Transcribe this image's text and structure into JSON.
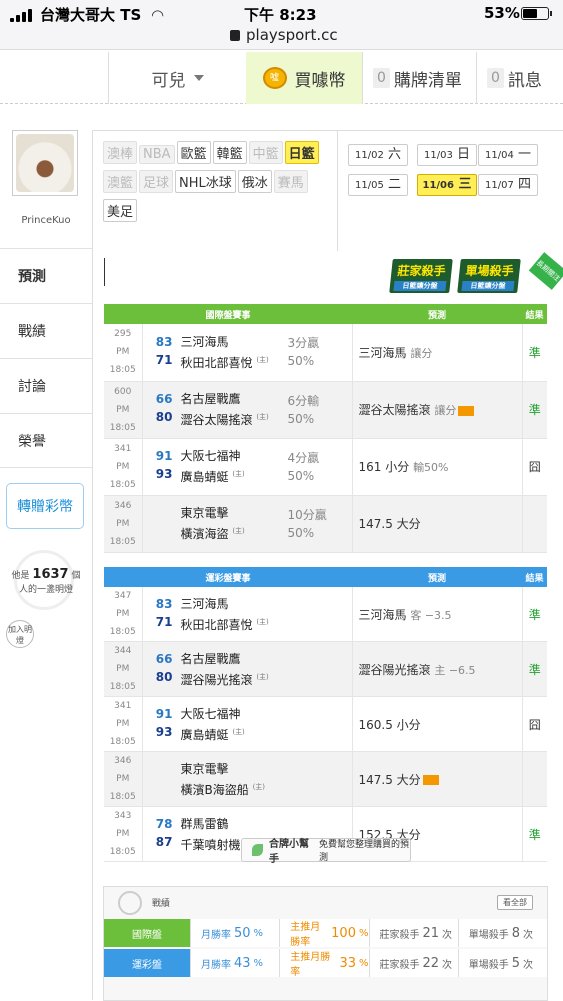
{
  "status_bar": {
    "carrier": "台灣大哥大 TS",
    "time": "下午 8:23",
    "url": "playsport.cc",
    "battery": "53%",
    "battery_level": 0.53
  },
  "top_nav": {
    "user_label": "可兒",
    "buy_label": "買噱幣",
    "coin_icon_text": "噓",
    "watch_count": "0",
    "watch_label": "購牌清單",
    "msg_count": "0",
    "msg_label": "訊息"
  },
  "profile": {
    "name": "PrinceKuo"
  },
  "left_nav": {
    "items": [
      "預測",
      "戰績",
      "討論",
      "榮譽"
    ],
    "gift_button": "轉贈彩幣",
    "bulb_prefix": "他是",
    "bulb_count": "1637",
    "bulb_suffix1": "個",
    "bulb_suffix2": "人的一盞明燈",
    "add_button": "加入明燈"
  },
  "sport_tags": [
    {
      "label": "澳棒",
      "state": "disabled"
    },
    {
      "label": "NBA",
      "state": "disabled"
    },
    {
      "label": "歐籃",
      "state": "normal"
    },
    {
      "label": "韓籃",
      "state": "normal"
    },
    {
      "label": "中籃",
      "state": "disabled"
    },
    {
      "label": "日籃",
      "state": "selected"
    },
    {
      "label": "澳籃",
      "state": "disabled"
    },
    {
      "label": "足球",
      "state": "disabled"
    },
    {
      "label": "NHL冰球",
      "state": "normal"
    },
    {
      "label": "俄冰",
      "state": "normal"
    },
    {
      "label": "賽馬",
      "state": "disabled"
    },
    {
      "label": "美足",
      "state": "normal"
    }
  ],
  "dates": [
    {
      "md": "11/02",
      "dow": "六"
    },
    {
      "md": "11/03",
      "dow": "日"
    },
    {
      "md": "11/04",
      "dow": "一"
    },
    {
      "md": "11/05",
      "dow": "二"
    },
    {
      "md": "11/06",
      "dow": "三"
    },
    {
      "md": "11/07",
      "dow": "四"
    }
  ],
  "badges": {
    "kill1_title": "莊家殺手",
    "kill1_sub": "日籃讓分盤",
    "kill2_title": "單場殺手",
    "kill2_sub": "日籃讓分盤",
    "ribbon": "長期關注"
  },
  "intl_table": {
    "header": {
      "game": "國際盤賽事",
      "pred": "預測",
      "result": "結果"
    },
    "color": "#6cbf3b",
    "rows": [
      {
        "id": "295",
        "time": "PM 18:05",
        "s1": "83",
        "t1": "三河海馬",
        "s2": "71",
        "t2": "秋田北部喜悅",
        "home": "(主)",
        "odds1": "3分贏",
        "odds2": "50%",
        "pred": "三河海馬",
        "pred_sub": "讓分",
        "hot": false,
        "result": "準"
      },
      {
        "id": "600",
        "time": "PM 18:05",
        "s1": "66",
        "t1": "名古屋戰鷹",
        "s2": "80",
        "t2": "澀谷太陽搖滾",
        "home": "(主)",
        "odds1": "6分輸",
        "odds2": "50%",
        "pred": "澀谷太陽搖滾",
        "pred_sub": "讓分",
        "hot": true,
        "result": "準"
      },
      {
        "id": "341",
        "time": "PM 18:05",
        "s1": "91",
        "t1": "大阪七福神",
        "s2": "93",
        "t2": "廣島蜻蜓",
        "home": "(主)",
        "odds1": "4分贏",
        "odds2": "50%",
        "pred": "161 小分",
        "pred_sub": "輸50%",
        "hot": false,
        "result": "囧"
      },
      {
        "id": "346",
        "time": "PM 18:05",
        "s1": "",
        "t1": "東京電擊",
        "s2": "",
        "t2": "橫濱海盜",
        "home": "(主)",
        "odds1": "10分贏",
        "odds2": "50%",
        "pred": "147.5 大分",
        "pred_sub": "",
        "hot": false,
        "result": ""
      }
    ]
  },
  "lottery_table": {
    "header": {
      "game": "運彩盤賽事",
      "pred": "預測",
      "result": "結果"
    },
    "color": "#3a9be4",
    "rows": [
      {
        "id": "347",
        "time": "PM 18:05",
        "s1": "83",
        "t1": "三河海馬",
        "s2": "71",
        "t2": "秋田北部喜悅",
        "home": "(主)",
        "pred": "三河海馬",
        "pred_sub": "客 −3.5",
        "hot": false,
        "result": "準"
      },
      {
        "id": "344",
        "time": "PM 18:05",
        "s1": "66",
        "t1": "名古屋戰鷹",
        "s2": "80",
        "t2": "澀谷陽光搖滾",
        "home": "(主)",
        "pred": "澀谷陽光搖滾",
        "pred_sub": "主 −6.5",
        "hot": false,
        "result": "準"
      },
      {
        "id": "341",
        "time": "PM 18:05",
        "s1": "91",
        "t1": "大阪七福神",
        "s2": "93",
        "t2": "廣島蜻蜓",
        "home": "(主)",
        "pred": "160.5 小分",
        "pred_sub": "",
        "hot": false,
        "result": "囧"
      },
      {
        "id": "346",
        "time": "PM 18:05",
        "s1": "",
        "t1": "東京電擊",
        "s2": "",
        "t2": "橫濱B海盜船",
        "home": "(主)",
        "pred": "147.5 大分",
        "pred_sub": "",
        "hot": true,
        "result": ""
      },
      {
        "id": "343",
        "time": "PM 18:05",
        "s1": "78",
        "t1": "群馬雷鶴",
        "s2": "87",
        "t2": "千葉噴射機",
        "home": "(主)",
        "pred": "152.5 大分",
        "pred_sub": "",
        "hot": false,
        "result": "準"
      }
    ]
  },
  "helper": {
    "title": "合牌小幫手",
    "desc": "免費幫您整理購買的預測"
  },
  "stats": {
    "title": "戰績",
    "all_button": "看全部",
    "rows": [
      {
        "label": "國際盤",
        "color": "#6cbf3b",
        "c1l": "月勝率",
        "c1v": "50",
        "c1u": "%",
        "c2l": "主推月勝率",
        "c2v": "100",
        "c2u": "%",
        "c3l": "莊家殺手",
        "c3v": "21",
        "c3u": "次",
        "c4l": "單場殺手",
        "c4v": "8",
        "c4u": "次"
      },
      {
        "label": "運彩盤",
        "color": "#3a9be4",
        "c1l": "月勝率",
        "c1v": "43",
        "c1u": "%",
        "c2l": "主推月勝率",
        "c2v": "33",
        "c2u": "%",
        "c3l": "莊家殺手",
        "c3v": "22",
        "c3u": "次",
        "c4l": "單場殺手",
        "c4v": "5",
        "c4u": "次"
      }
    ]
  }
}
